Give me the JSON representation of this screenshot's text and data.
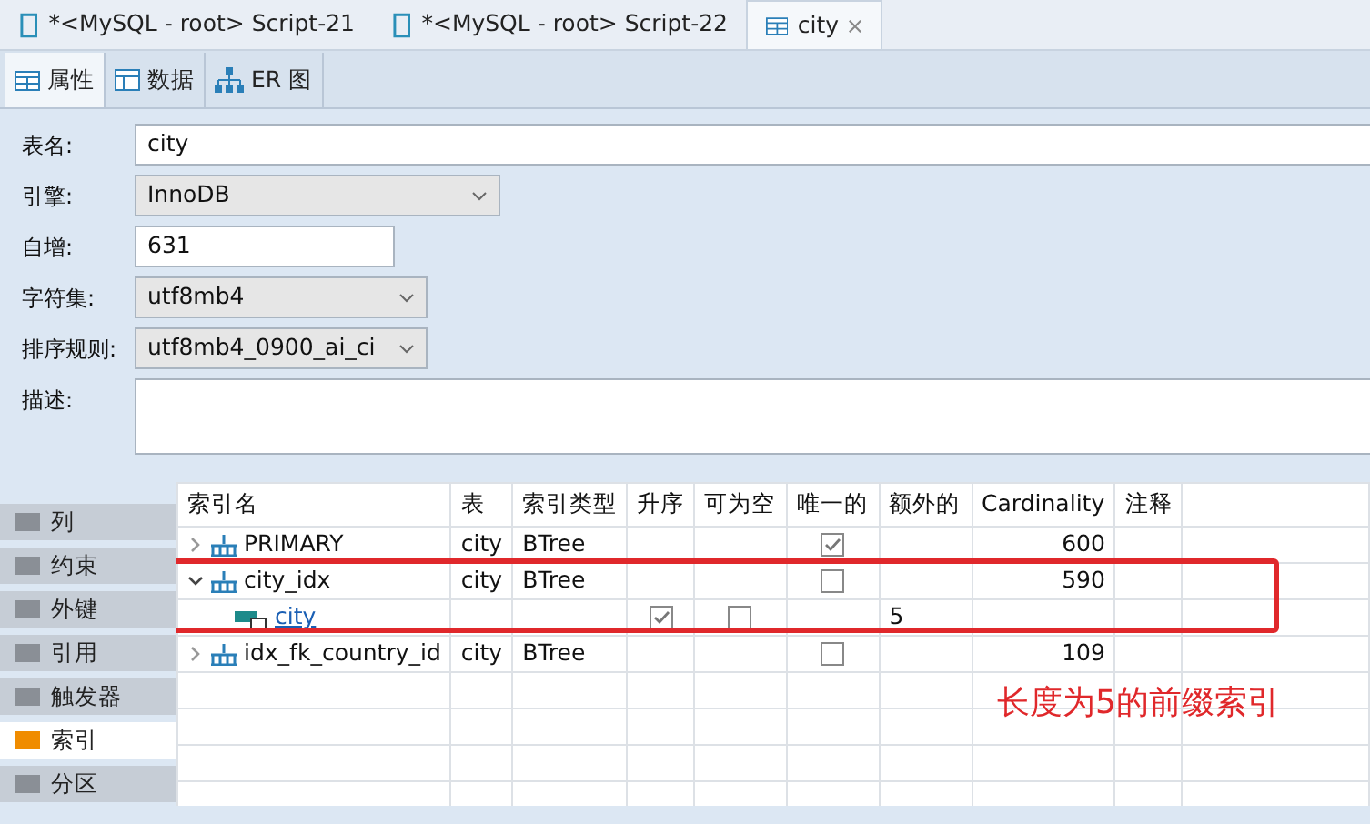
{
  "editor_tabs": [
    {
      "label": "*<MySQL - root> Script-21",
      "kind": "script",
      "selected": false
    },
    {
      "label": "*<MySQL - root> Script-22",
      "kind": "script",
      "selected": false
    },
    {
      "label": "city",
      "kind": "table",
      "selected": true,
      "closable": true
    }
  ],
  "sub_tabs": [
    {
      "label": "属性",
      "kind": "table",
      "selected": true
    },
    {
      "label": "数据",
      "kind": "data",
      "selected": false
    },
    {
      "label": "ER 图",
      "kind": "er",
      "selected": false
    }
  ],
  "form": [
    {
      "label": "表名:",
      "value": "city",
      "kind": "text"
    },
    {
      "label": "引擎:",
      "value": "InnoDB",
      "kind": "select"
    },
    {
      "label": "自增:",
      "value": "631",
      "kind": "text"
    },
    {
      "label": "字符集:",
      "value": "utf8mb4",
      "kind": "select"
    },
    {
      "label": "排序规则:",
      "value": "utf8mb4_0900_ai_ci",
      "kind": "select"
    },
    {
      "label": "描述:",
      "kind": "textarea"
    }
  ],
  "side_nav": [
    {
      "label": "列",
      "selected": false
    },
    {
      "label": "约束",
      "selected": false
    },
    {
      "label": "外键",
      "selected": false
    },
    {
      "label": "引用",
      "selected": false
    },
    {
      "label": "触发器",
      "selected": false
    },
    {
      "label": "索引",
      "selected": true
    },
    {
      "label": "分区",
      "selected": false
    }
  ],
  "index_table": {
    "columns": [
      "索引名",
      "表",
      "索引类型",
      "升序",
      "可为空",
      "唯一的",
      "额外的",
      "Cardinality",
      "注释"
    ],
    "rows": [
      {
        "name": "PRIMARY",
        "table": "city",
        "type": "BTree",
        "unique": true,
        "cardinality": "600",
        "expanded": false
      },
      {
        "name": "city_idx",
        "table": "city",
        "type": "BTree",
        "unique": false,
        "cardinality": "590",
        "expanded": true,
        "children": [
          {
            "name": "city",
            "ascending": true,
            "nullable": false,
            "extra": "5"
          }
        ]
      },
      {
        "name": "idx_fk_country_id",
        "table": "city",
        "type": "BTree",
        "unique": false,
        "cardinality": "109",
        "expanded": false
      }
    ]
  },
  "annotation": {
    "text": "长度为5的前缀索引"
  }
}
